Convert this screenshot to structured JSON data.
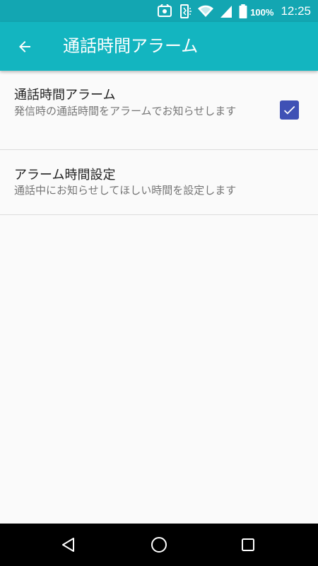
{
  "status_bar": {
    "battery_percent": "100%",
    "time": "12:25",
    "icons": [
      "nfc-icon",
      "vibrate-icon",
      "wifi-icon",
      "signal-icon",
      "battery-icon"
    ]
  },
  "app_bar": {
    "back_icon": "arrow-left-icon",
    "title": "通話時間アラーム"
  },
  "settings": [
    {
      "title": "通話時間アラーム",
      "summary": "発信時の通話時間をアラームでお知らせします",
      "checked": true
    },
    {
      "title": "アラーム時間設定",
      "summary": "通話中にお知らせしてほしい時間を設定します"
    }
  ],
  "navigation": {
    "icons": [
      "triangle-back-icon",
      "circle-home-icon",
      "square-recent-icon"
    ]
  },
  "colors": {
    "status_bar": "#13a6b2",
    "app_bar": "#13b5c0",
    "checkbox": "#3f51b5",
    "background": "#fafafa"
  }
}
